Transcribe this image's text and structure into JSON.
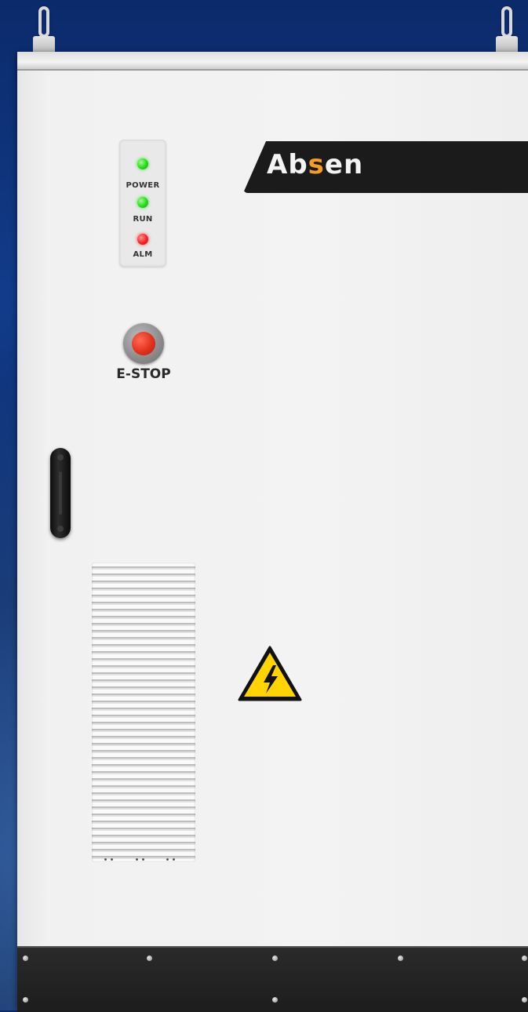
{
  "brand": {
    "logo_text": "Absen",
    "logo_color": "#f4f4f4",
    "logo_accent": "#f39c28"
  },
  "indicators": [
    {
      "label": "POWER",
      "color": "#27d81c"
    },
    {
      "label": "RUN",
      "color": "#27d81c"
    },
    {
      "label": "ALM",
      "color": "#f02424"
    }
  ],
  "estop": {
    "label": "E-STOP",
    "color": "#e3311d"
  },
  "icons": {
    "warning": "high-voltage-warning-icon",
    "handle": "door-handle-icon",
    "vent": "ventilation-grille-icon"
  }
}
